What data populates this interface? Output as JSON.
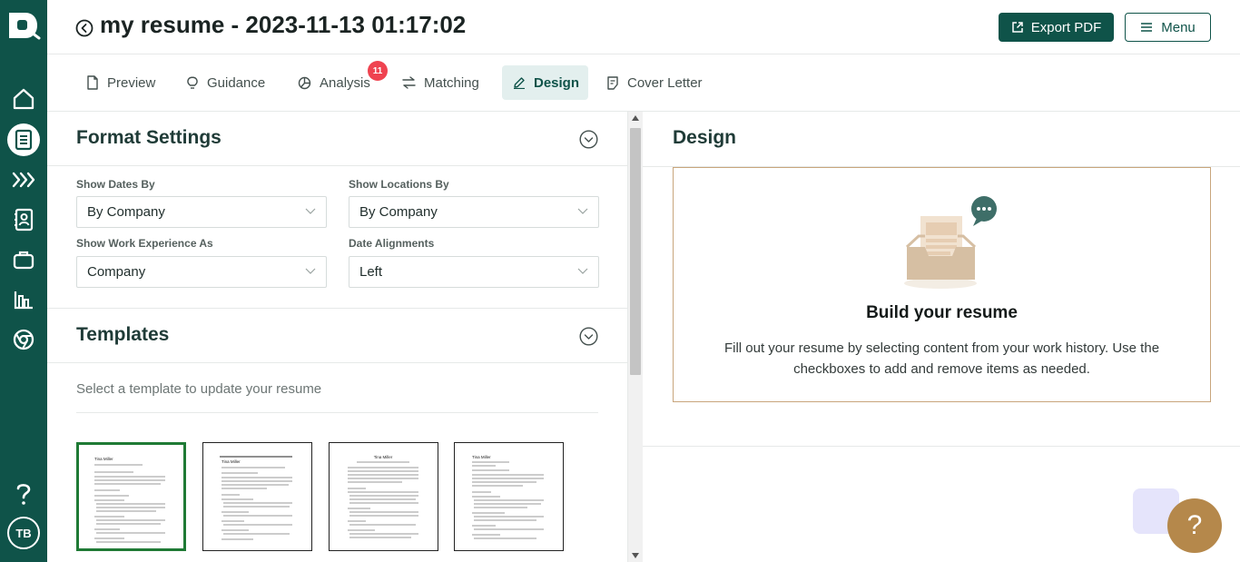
{
  "sidebar": {
    "icons": [
      "logo-icon",
      "home-icon",
      "resume-icon",
      "pipeline-icon",
      "contacts-icon",
      "briefcase-icon",
      "chart-icon",
      "chrome-icon",
      "help-icon"
    ],
    "avatar_initials": "TB"
  },
  "header": {
    "title": "my resume - 2023-11-13 01:17:02",
    "export_label": "Export PDF",
    "menu_label": "Menu"
  },
  "tabs": [
    {
      "label": "Preview",
      "icon": "document-icon"
    },
    {
      "label": "Guidance",
      "icon": "lightbulb-icon"
    },
    {
      "label": "Analysis",
      "icon": "pie-chart-icon",
      "badge": "11"
    },
    {
      "label": "Matching",
      "icon": "arrows-icon"
    },
    {
      "label": "Design",
      "icon": "pencil-icon",
      "active": true
    },
    {
      "label": "Cover Letter",
      "icon": "note-icon"
    }
  ],
  "format_settings": {
    "title": "Format Settings",
    "fields": [
      {
        "label": "Show Dates By",
        "value": "By Company"
      },
      {
        "label": "Show Locations By",
        "value": "By Company"
      },
      {
        "label": "Show Work Experience As",
        "value": "Company"
      },
      {
        "label": "Date Alignments",
        "value": "Left"
      }
    ]
  },
  "templates": {
    "title": "Templates",
    "hint": "Select a template to update your resume",
    "selected_index": 0,
    "previews": [
      {
        "name": "Tina Miller"
      },
      {
        "name": "Tina Miller"
      },
      {
        "name": "Tina Miller"
      },
      {
        "name": "Tina Miller"
      }
    ]
  },
  "design": {
    "title": "Design",
    "card_title": "Build your resume",
    "card_text": "Fill out your resume by selecting content from your work history. Use the checkboxes to add and remove items as needed."
  },
  "help_button": "?",
  "colors": {
    "brand": "#0f5349",
    "badge": "#ef4350",
    "card_border": "#c8a57c",
    "help": "#b5884b"
  }
}
